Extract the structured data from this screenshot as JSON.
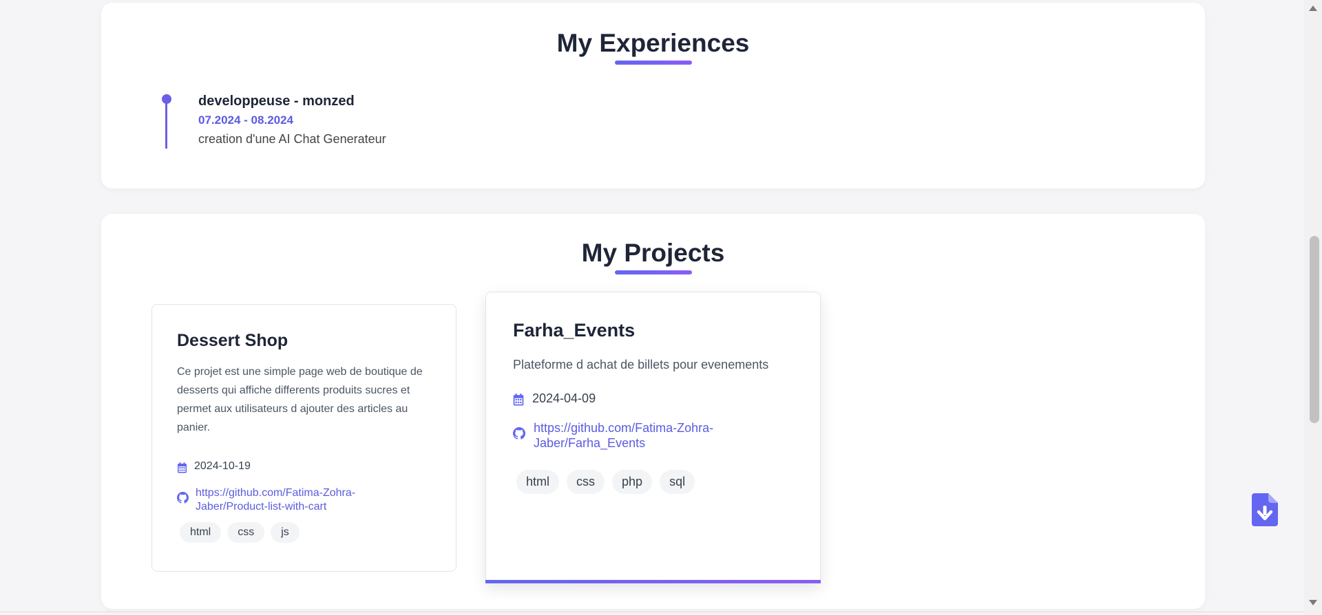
{
  "experiences": {
    "title": "My Experiences",
    "items": [
      {
        "role": "developpeuse - monzed",
        "dates": "07.2024 - 08.2024",
        "description": "creation d'une AI Chat Generateur"
      }
    ]
  },
  "projects": {
    "title": "My Projects",
    "items": [
      {
        "name": "Dessert Shop",
        "description": "Ce projet est une simple page web de boutique de desserts qui affiche differents produits sucres et permet aux utilisateurs d ajouter des articles au panier.",
        "date": "2024-10-19",
        "link_line1": "https://github.com/Fatima-Zohra-",
        "link_line2": "Jaber/Product-list-with-cart",
        "tags": [
          "html",
          "css",
          "js"
        ]
      },
      {
        "name": "Farha_Events",
        "description": "Plateforme d achat de billets pour evenements",
        "date": "2024-04-09",
        "link_line1": "https://github.com/Fatima-Zohra-",
        "link_line2": "Jaber/Farha_Events",
        "tags": [
          "html",
          "css",
          "php",
          "sql"
        ]
      }
    ]
  },
  "icons": {
    "date": "calendar-icon",
    "link": "github-icon",
    "download": "file-download-icon",
    "scroll_up": "scroll-up-arrow-icon",
    "scroll_down": "scroll-down-arrow-icon"
  },
  "colors": {
    "accent": "#6366f1",
    "accent_purple": "#8b5cf6",
    "link": "#5b5be0",
    "heading": "#1e2537"
  }
}
